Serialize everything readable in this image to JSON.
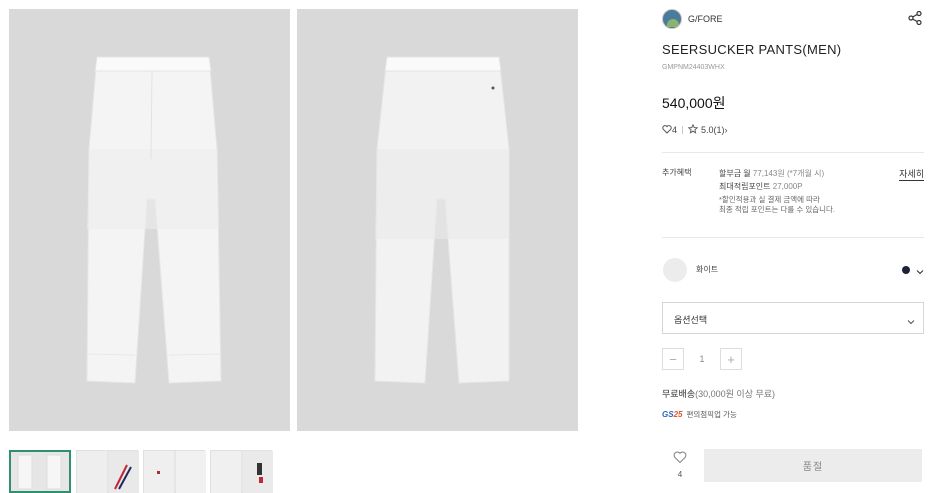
{
  "brand": {
    "name": "G/FORE"
  },
  "product": {
    "title": "SEERSUCKER PANTS(MEN)",
    "code": "GMPNM24403WHX",
    "price": "540,000원",
    "likes": "4",
    "rating": "5.0(1)",
    "rating_arrow": "›"
  },
  "benefits": {
    "label": "추가혜택",
    "installment_prefix": "할부금 월 ",
    "installment_value": "77,143원 (*7개월 시)",
    "points_prefix": "최대적립포인트 ",
    "points_value": "27,000P",
    "note_line1": "*할인적용과 실 결제 금액에 따라",
    "note_line2": "최종 적립 포인트는 다를 수 있습니다.",
    "detail_link": "자세히"
  },
  "color": {
    "name": "화이트",
    "dot_color": "#1e2238"
  },
  "option_select": {
    "placeholder": "옵션선택"
  },
  "quantity": {
    "minus": "−",
    "value": "1",
    "plus": "+"
  },
  "shipping": {
    "prefix": "무료배송",
    "condition": "(30,000원 이상 무료)",
    "gs_logo": "GS",
    "gs_logo_num": "25",
    "gs_text": "편의점픽업 가능"
  },
  "actions": {
    "wish_count": "4",
    "soldout_label": "품절"
  },
  "icons": {
    "share": "share-icon",
    "heart": "heart-icon",
    "star": "star-icon",
    "chevron": "chevron-down-icon",
    "wish": "wishlist-heart-icon"
  }
}
